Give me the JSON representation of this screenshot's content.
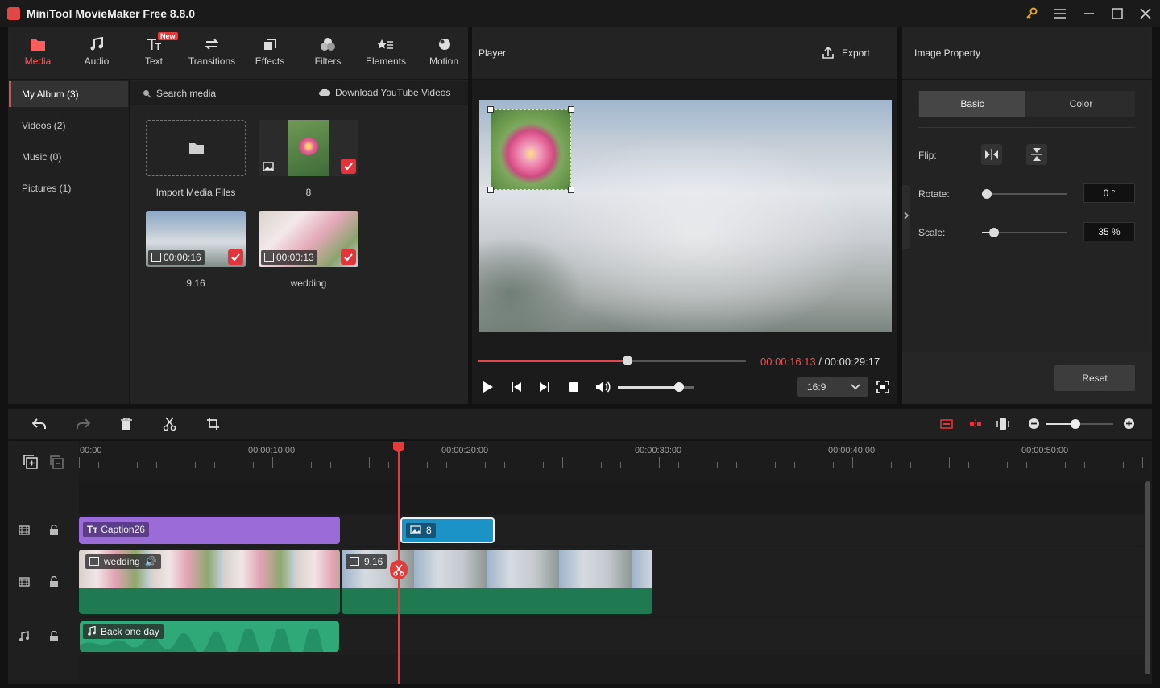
{
  "app": {
    "title": "MiniTool MovieMaker Free 8.8.0"
  },
  "toolbar": {
    "tabs": [
      {
        "label": "Media"
      },
      {
        "label": "Audio"
      },
      {
        "label": "Text"
      },
      {
        "label": "Transitions"
      },
      {
        "label": "Effects"
      },
      {
        "label": "Filters"
      },
      {
        "label": "Elements"
      },
      {
        "label": "Motion"
      }
    ],
    "new_badge": "New",
    "active_tab": "Media"
  },
  "media": {
    "albums": [
      {
        "label": "My Album (3)"
      },
      {
        "label": "Videos (2)"
      },
      {
        "label": "Music (0)"
      },
      {
        "label": "Pictures (1)"
      }
    ],
    "search_placeholder": "Search media",
    "download_label": "Download YouTube Videos",
    "items": [
      {
        "label": "Import Media Files"
      },
      {
        "label": "8"
      },
      {
        "label": "9.16",
        "duration": "00:00:16"
      },
      {
        "label": "wedding",
        "duration": "00:00:13"
      }
    ]
  },
  "player": {
    "title": "Player",
    "export_label": "Export",
    "current_time": "00:00:16:13",
    "separator": " / ",
    "total_time": "00:00:29:17",
    "progress": 0.56,
    "volume": 0.8,
    "aspect_ratio": "16:9"
  },
  "property": {
    "title": "Image Property",
    "tabs": [
      {
        "label": "Basic"
      },
      {
        "label": "Color"
      }
    ],
    "flip_label": "Flip:",
    "rotate_label": "Rotate:",
    "rotate_value": "0 °",
    "scale_label": "Scale:",
    "scale_value": "35 %",
    "reset_label": "Reset"
  },
  "timeline": {
    "ruler": [
      "00:00",
      "00:00:10:00",
      "00:00:20:00",
      "00:00:30:00",
      "00:00:40:00",
      "00:00:50:00"
    ],
    "clips": {
      "caption": "Caption26",
      "image": "8",
      "video1": "wedding",
      "video2": "9.16",
      "audio": "Back one day"
    }
  },
  "colors": {
    "accent": "#e24646",
    "caption_clip": "#9b6bd8",
    "image_clip": "#1b93c7",
    "video_bar": "#1f7a52",
    "audio_clip": "#2fa978"
  }
}
